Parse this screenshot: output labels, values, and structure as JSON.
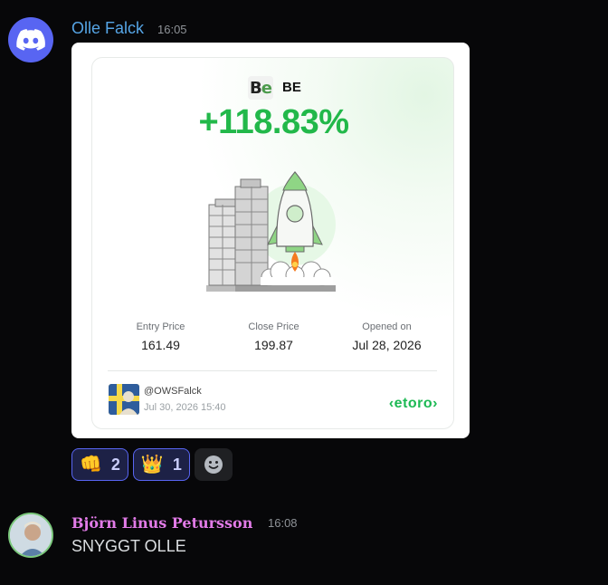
{
  "message1": {
    "author": "Olle Falck",
    "timestamp": "16:05",
    "avatar_icon": "discord-logo-icon",
    "embed": {
      "ticker_logo": {
        "b": "B",
        "e": "e"
      },
      "ticker": "BE",
      "percent_change": "+118.83%",
      "illustration": "rocket-launch-icon",
      "stats": [
        {
          "label": "Entry Price",
          "value": "161.49"
        },
        {
          "label": "Close Price",
          "value": "199.87"
        },
        {
          "label": "Opened on",
          "value": "Jul 28, 2026"
        }
      ],
      "user_handle": "@OWSFalck",
      "shared_date": "Jul 30, 2026 15:40",
      "brand": "‹etoro›"
    },
    "reactions": [
      {
        "emoji": "👊",
        "icon": "fist-emoji-icon",
        "count": "2"
      },
      {
        "emoji": "👑",
        "icon": "crown-emoji-icon",
        "count": "1"
      }
    ],
    "add_reaction_icon": "add-reaction-icon"
  },
  "message2": {
    "author": "Björn Linus Petursson",
    "timestamp": "16:08",
    "content": "SNYGGT OLLE"
  },
  "colors": {
    "background": "#070709",
    "olle_name": "#56a5e6",
    "bjorn_name": "#e27be8",
    "gain_green": "#22b84a",
    "discord_blurple": "#5865f2"
  }
}
